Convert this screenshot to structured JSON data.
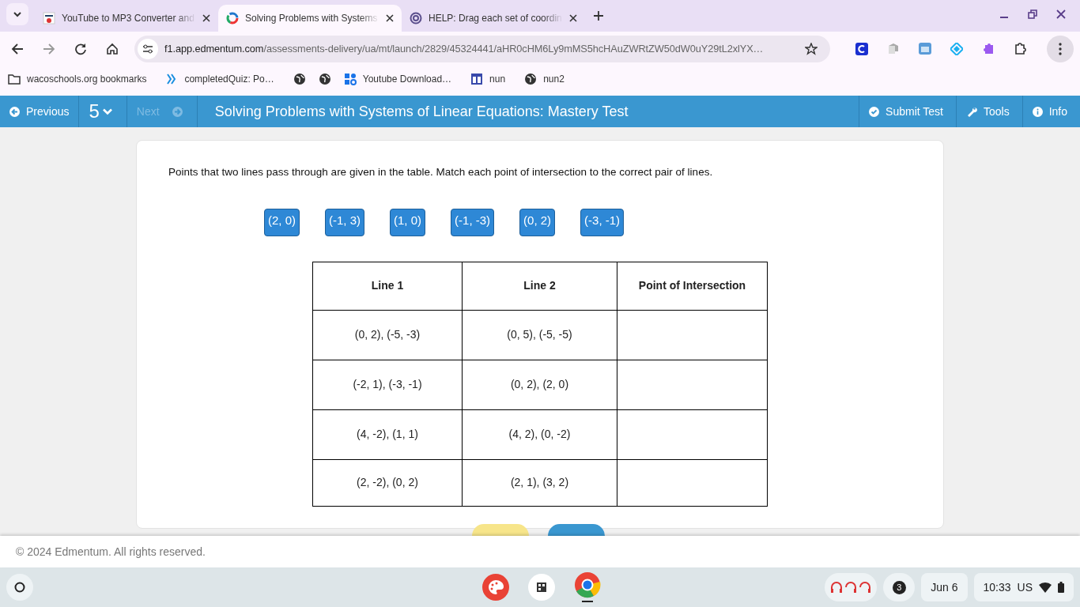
{
  "browser": {
    "tabs": [
      {
        "title": "YouTube to MP3 Converter and",
        "selected": false
      },
      {
        "title": "Solving Problems with Systems",
        "selected": true
      },
      {
        "title": "HELP: Drag each set of coordin",
        "selected": false
      }
    ],
    "url_host": "f1.app.edmentum.com",
    "url_path": "/assessments-delivery/ua/mt/launch/2829/45324441/aHR0cHM6Ly9mMS5hcHAuZWRtZW50dW0uY29tL2xlYX…",
    "bookmarks": [
      {
        "kind": "folder",
        "label": "wacoschools.org bookmarks"
      },
      {
        "kind": "chevrons",
        "label": "completedQuiz: Po…"
      },
      {
        "kind": "globe"
      },
      {
        "kind": "globe"
      },
      {
        "kind": "shapes",
        "label": "Youtube Download…"
      },
      {
        "kind": "window",
        "label": "nun"
      },
      {
        "kind": "globe",
        "label": "nun2"
      }
    ]
  },
  "app_nav": {
    "previous": "Previous",
    "question_number": "5",
    "next": "Next",
    "next_disabled": true,
    "title": "Solving Problems with Systems of Linear Equations: Mastery Test",
    "actions": [
      {
        "kind": "check",
        "label": "Submit Test"
      },
      {
        "kind": "wrench",
        "label": "Tools"
      },
      {
        "kind": "info",
        "label": "Info"
      }
    ]
  },
  "question": {
    "prompt": "Points that two lines pass through are given in the table. Match each point of intersection to the correct pair of lines.",
    "tiles": [
      "(2, 0)",
      "(-1, 3)",
      "(1, 0)",
      "(-1, -3)",
      "(0, 2)",
      "(-3, -1)"
    ],
    "table": {
      "columns": [
        "Line 1",
        "Line 2",
        "Point of Intersection"
      ],
      "rows": [
        [
          "(0, 2), (-5, -3)",
          "(0, 5), (-5, -5)",
          ""
        ],
        [
          "(-2, 1), (-3, -1)",
          "(0, 2), (2, 0)",
          ""
        ],
        [
          "(4, -2), (1, 1)",
          "(4, 2), (0, -2)",
          ""
        ],
        [
          "(2, -2), (0, 2)",
          "(2, 1), (3, 2)",
          ""
        ]
      ]
    }
  },
  "footer": "© 2024 Edmentum. All rights reserved.",
  "taskbar": {
    "notifications": "3",
    "date": "Jun 6",
    "time": "10:33",
    "keyboard": "US"
  }
}
